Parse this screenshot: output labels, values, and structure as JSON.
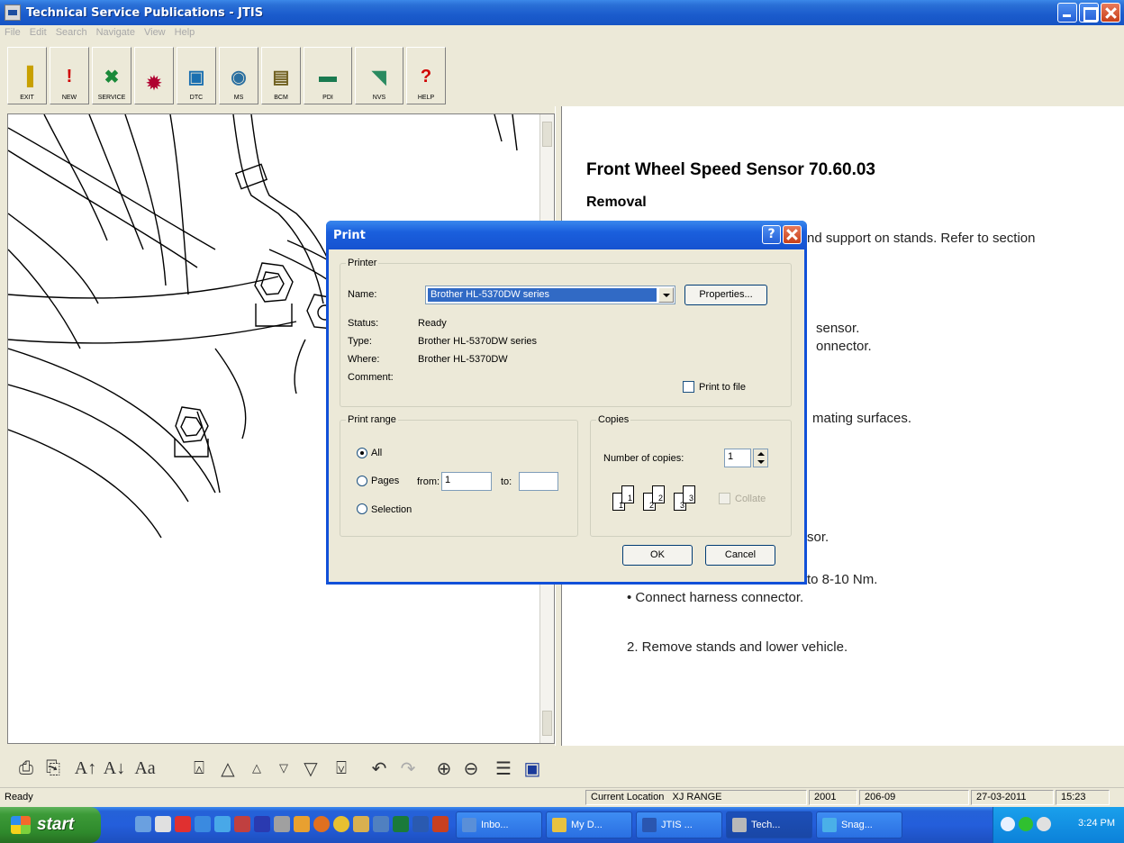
{
  "window": {
    "title": "Technical Service Publications - JTIS"
  },
  "menu": [
    "File",
    "Edit",
    "Search",
    "Navigate",
    "View",
    "Help"
  ],
  "toolbar": [
    {
      "label": "EXIT",
      "icon": "exit-icon"
    },
    {
      "label": "NEW",
      "icon": "exclamation-icon"
    },
    {
      "label": "SERVICE",
      "icon": "wrench-icon"
    },
    {
      "label": "",
      "icon": "engine-icon"
    },
    {
      "label": "DTC",
      "icon": "diagnostic-icon"
    },
    {
      "label": "MS",
      "icon": "camera-icon"
    },
    {
      "label": "BCM",
      "icon": "module-icon"
    },
    {
      "label": "PDI",
      "icon": "car-inspection-icon"
    },
    {
      "label": "NVS",
      "icon": "vehicle-icon"
    },
    {
      "label": "HELP",
      "icon": "question-icon"
    }
  ],
  "document": {
    "title": "Front Wheel Speed Sensor 70.60.03",
    "section": "Removal",
    "lines": [
      "nd support on stands. Refer to section",
      "sensor.",
      "onnector.",
      "mating surfaces.",
      "sor.",
      "to 8-10 Nm.",
      "• Connect harness connector.",
      "2. Remove stands and lower vehicle."
    ]
  },
  "print_dialog": {
    "title": "Print",
    "printer_group": "Printer",
    "name_label": "Name:",
    "name_value": "Brother HL-5370DW series",
    "properties_button": "Properties...",
    "status_label": "Status:",
    "status_value": "Ready",
    "type_label": "Type:",
    "type_value": "Brother HL-5370DW series",
    "where_label": "Where:",
    "where_value": "Brother HL-5370DW",
    "comment_label": "Comment:",
    "print_to_file": "Print to file",
    "range_group": "Print range",
    "range_all": "All",
    "range_pages": "Pages",
    "from_label": "from:",
    "from_value": "1",
    "to_label": "to:",
    "to_value": "",
    "range_selection": "Selection",
    "copies_group": "Copies",
    "copies_label": "Number of copies:",
    "copies_value": "1",
    "collate": "Collate",
    "ok_button": "OK",
    "cancel_button": "Cancel"
  },
  "status_bar": {
    "ready": "Ready",
    "current_location_label": "Current Location",
    "location": "XJ RANGE",
    "year": "2001",
    "section_code": "206-09",
    "date": "27-03-2011",
    "time": "15:23"
  },
  "taskbar": {
    "start": "start",
    "tasks": [
      {
        "label": "Inbo...",
        "color": "#5a8fd8"
      },
      {
        "label": "My D...",
        "color": "#e8c240"
      },
      {
        "label": "JTIS ...",
        "color": "#2a56b0"
      },
      {
        "label": "Tech...",
        "color": "#b8b8b8"
      },
      {
        "label": "Snag...",
        "color": "#4ab0e8"
      }
    ],
    "clock": "3:24 PM"
  }
}
